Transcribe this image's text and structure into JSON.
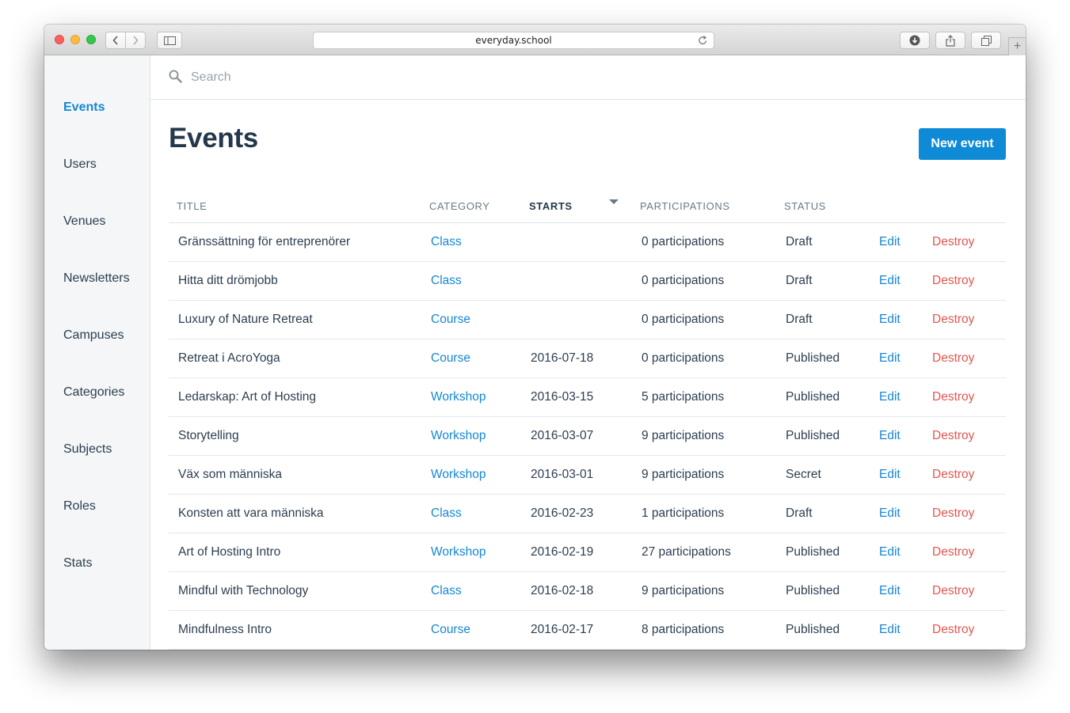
{
  "browser": {
    "url": "everyday.school"
  },
  "sidebar": {
    "items": [
      {
        "label": "Events"
      },
      {
        "label": "Users"
      },
      {
        "label": "Venues"
      },
      {
        "label": "Newsletters"
      },
      {
        "label": "Campuses"
      },
      {
        "label": "Categories"
      },
      {
        "label": "Subjects"
      },
      {
        "label": "Roles"
      },
      {
        "label": "Stats"
      }
    ],
    "active": "Events"
  },
  "search": {
    "placeholder": "Search",
    "value": ""
  },
  "page": {
    "title": "Events",
    "new_button": "New event"
  },
  "table": {
    "headers": {
      "title": "Title",
      "category": "Category",
      "starts": "Starts",
      "participations": "Participations",
      "status": "Status"
    },
    "rows": [
      {
        "title": "Gränssättning för entreprenörer",
        "category": "Class",
        "starts": "",
        "participations": "0 participations",
        "status": "Draft",
        "edit": "Edit",
        "destroy": "Destroy"
      },
      {
        "title": "Hitta ditt drömjobb",
        "category": "Class",
        "starts": "",
        "participations": "0 participations",
        "status": "Draft",
        "edit": "Edit",
        "destroy": "Destroy"
      },
      {
        "title": "Luxury of Nature Retreat",
        "category": "Course",
        "starts": "",
        "participations": "0 participations",
        "status": "Draft",
        "edit": "Edit",
        "destroy": "Destroy"
      },
      {
        "title": "Retreat i AcroYoga",
        "category": "Course",
        "starts": "2016-07-18",
        "participations": "0 participations",
        "status": "Published",
        "edit": "Edit",
        "destroy": "Destroy"
      },
      {
        "title": "Ledarskap: Art of Hosting",
        "category": "Workshop",
        "starts": "2016-03-15",
        "participations": "5 participations",
        "status": "Published",
        "edit": "Edit",
        "destroy": "Destroy"
      },
      {
        "title": "Storytelling",
        "category": "Workshop",
        "starts": "2016-03-07",
        "participations": "9 participations",
        "status": "Published",
        "edit": "Edit",
        "destroy": "Destroy"
      },
      {
        "title": "Väx som människa",
        "category": "Workshop",
        "starts": "2016-03-01",
        "participations": "9 participations",
        "status": "Secret",
        "edit": "Edit",
        "destroy": "Destroy"
      },
      {
        "title": "Konsten att vara människa",
        "category": "Class",
        "starts": "2016-02-23",
        "participations": "1 participations",
        "status": "Draft",
        "edit": "Edit",
        "destroy": "Destroy"
      },
      {
        "title": "Art of Hosting Intro",
        "category": "Workshop",
        "starts": "2016-02-19",
        "participations": "27 participations",
        "status": "Published",
        "edit": "Edit",
        "destroy": "Destroy"
      },
      {
        "title": "Mindful with Technology",
        "category": "Class",
        "starts": "2016-02-18",
        "participations": "9 participations",
        "status": "Published",
        "edit": "Edit",
        "destroy": "Destroy"
      },
      {
        "title": "Mindfulness Intro",
        "category": "Course",
        "starts": "2016-02-17",
        "participations": "8 participations",
        "status": "Published",
        "edit": "Edit",
        "destroy": "Destroy"
      }
    ]
  },
  "colors": {
    "accent": "#0e8ad6",
    "link": "#1487d4",
    "danger": "#e0574f",
    "heading": "#24384c"
  },
  "icons": {
    "search": "search-icon",
    "sort": "sort-desc-icon",
    "help": "help-chat-icon"
  }
}
